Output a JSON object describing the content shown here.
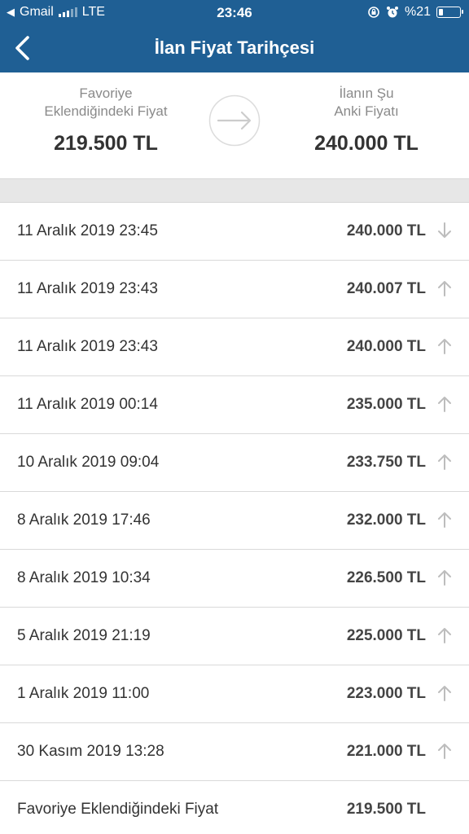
{
  "status_bar": {
    "back_app": "Gmail",
    "network": "LTE",
    "time": "23:46",
    "battery": "%21",
    "battery_level": 0.21
  },
  "nav": {
    "title": "İlan Fiyat Tarihçesi",
    "back_icon": "chevron-left-icon"
  },
  "summary": {
    "left_label_line1": "Favoriye",
    "left_label_line2": "Eklendiğindeki Fiyat",
    "left_value": "219.500 TL",
    "right_label_line1": "İlanın Şu",
    "right_label_line2": "Anki Fiyatı",
    "right_value": "240.000 TL",
    "arrow_icon": "arrow-right-icon"
  },
  "history": [
    {
      "date": "11 Aralık 2019 23:45",
      "price": "240.000 TL",
      "trend": "down"
    },
    {
      "date": "11 Aralık 2019 23:43",
      "price": "240.007 TL",
      "trend": "up"
    },
    {
      "date": "11 Aralık 2019 23:43",
      "price": "240.000 TL",
      "trend": "up"
    },
    {
      "date": "11 Aralık 2019 00:14",
      "price": "235.000 TL",
      "trend": "up"
    },
    {
      "date": "10 Aralık 2019 09:04",
      "price": "233.750 TL",
      "trend": "up"
    },
    {
      "date": "8 Aralık 2019 17:46",
      "price": "232.000 TL",
      "trend": "up"
    },
    {
      "date": "8 Aralık 2019 10:34",
      "price": "226.500 TL",
      "trend": "up"
    },
    {
      "date": "5 Aralık 2019 21:19",
      "price": "225.000 TL",
      "trend": "up"
    },
    {
      "date": "1 Aralık 2019 11:00",
      "price": "223.000 TL",
      "trend": "up"
    },
    {
      "date": "30 Kasım 2019 13:28",
      "price": "221.000 TL",
      "trend": "up"
    },
    {
      "date": "Favoriye Eklendiğindeki Fiyat",
      "price": "219.500 TL",
      "trend": "none"
    }
  ],
  "colors": {
    "header_bg": "#1f5f94",
    "text_dark": "#333333",
    "text_muted": "#8a8a8a",
    "arrow_gray": "#bdbdbd",
    "divider": "#d9d9d9",
    "separator_bg": "#e7e7e7"
  }
}
